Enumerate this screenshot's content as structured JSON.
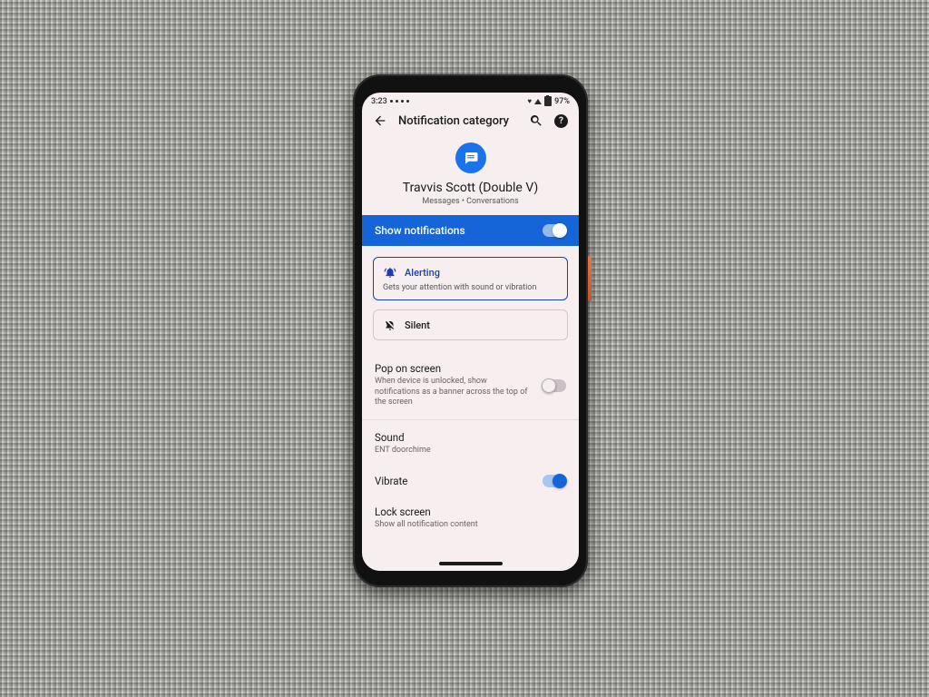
{
  "status": {
    "time": "3:23",
    "battery": "97%"
  },
  "appbar": {
    "title": "Notification category"
  },
  "hero": {
    "name": "Travvis Scott (Double V)",
    "subtitle": "Messages • Conversations"
  },
  "show_notifications": {
    "label": "Show notifications",
    "on": true
  },
  "behavior": {
    "alerting": {
      "label": "Alerting",
      "desc": "Gets your attention with sound or vibration"
    },
    "silent": {
      "label": "Silent"
    }
  },
  "settings": {
    "pop": {
      "title": "Pop on screen",
      "sub": "When device is unlocked, show notifications as a banner across the top of the screen",
      "on": false
    },
    "sound": {
      "title": "Sound",
      "sub": "ENT doorchime"
    },
    "vibrate": {
      "title": "Vibrate",
      "on": true
    },
    "lock": {
      "title": "Lock screen",
      "sub": "Show all notification content"
    }
  }
}
